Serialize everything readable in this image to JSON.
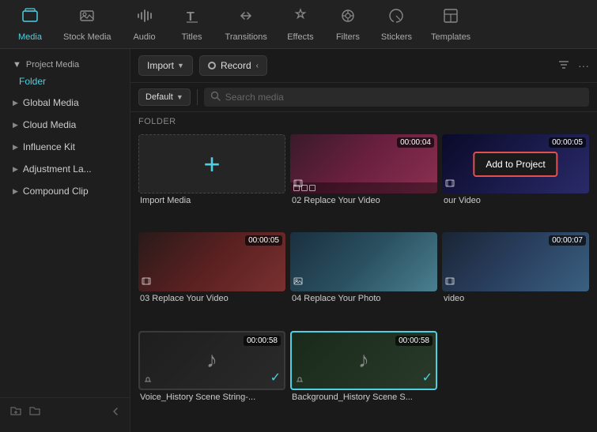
{
  "toolbar": {
    "items": [
      {
        "id": "media",
        "label": "Media",
        "icon": "⬛",
        "active": true
      },
      {
        "id": "stock-media",
        "label": "Stock Media",
        "icon": "🎬"
      },
      {
        "id": "audio",
        "label": "Audio",
        "icon": "♪"
      },
      {
        "id": "titles",
        "label": "Titles",
        "icon": "T"
      },
      {
        "id": "transitions",
        "label": "Transitions",
        "icon": "▶"
      },
      {
        "id": "effects",
        "label": "Effects",
        "icon": "✦"
      },
      {
        "id": "filters",
        "label": "Filters",
        "icon": "◈"
      },
      {
        "id": "stickers",
        "label": "Stickers",
        "icon": "★"
      },
      {
        "id": "templates",
        "label": "Templates",
        "icon": "⊡"
      }
    ]
  },
  "sidebar": {
    "project_media_label": "Project Media",
    "folder_label": "Folder",
    "items": [
      {
        "id": "global-media",
        "label": "Global Media"
      },
      {
        "id": "cloud-media",
        "label": "Cloud Media"
      },
      {
        "id": "influence-kit",
        "label": "Influence Kit"
      },
      {
        "id": "adjustment-la",
        "label": "Adjustment La..."
      },
      {
        "id": "compound-clip",
        "label": "Compound Clip"
      }
    ],
    "footer_icons": [
      "folder-add",
      "folder",
      "arrow-left"
    ]
  },
  "topbar": {
    "import_label": "Import",
    "record_label": "Record",
    "record_arrow": "<"
  },
  "searchbar": {
    "default_label": "Default",
    "search_placeholder": "Search media"
  },
  "folder_section_label": "FOLDER",
  "media_grid": {
    "items": [
      {
        "id": "import-media",
        "type": "import",
        "label": "Import Media"
      },
      {
        "id": "video-02",
        "type": "video",
        "label": "02 Replace Your Video",
        "duration": "00:00:04",
        "thumb_class": "thumb-party",
        "has_filmstrip": true
      },
      {
        "id": "video-02b",
        "type": "video",
        "label": "our Video",
        "duration": "00:00:05",
        "thumb_class": "thumb-singer",
        "has_popup": true,
        "popup_label": "Add to Project"
      },
      {
        "id": "video-03",
        "type": "video",
        "label": "03 Replace Your Video",
        "duration": "00:00:05",
        "thumb_class": "thumb-women",
        "has_filmstrip": true
      },
      {
        "id": "photo-04",
        "type": "image",
        "label": "04 Replace Your Photo",
        "thumb_class": "thumb-beach",
        "has_image_icon": true
      },
      {
        "id": "video-05",
        "type": "video",
        "label": "video",
        "duration": "00:00:07",
        "thumb_class": "thumb-beach",
        "has_filmstrip": true
      },
      {
        "id": "audio-voice",
        "type": "audio",
        "label": "Voice_History Scene String-...",
        "duration": "00:00:58",
        "thumb_class": "thumb-audio1",
        "has_check": true
      },
      {
        "id": "audio-bg",
        "type": "audio",
        "label": "Background_History Scene S...",
        "duration": "00:00:58",
        "thumb_class": "thumb-audio2",
        "has_check": true
      }
    ]
  }
}
